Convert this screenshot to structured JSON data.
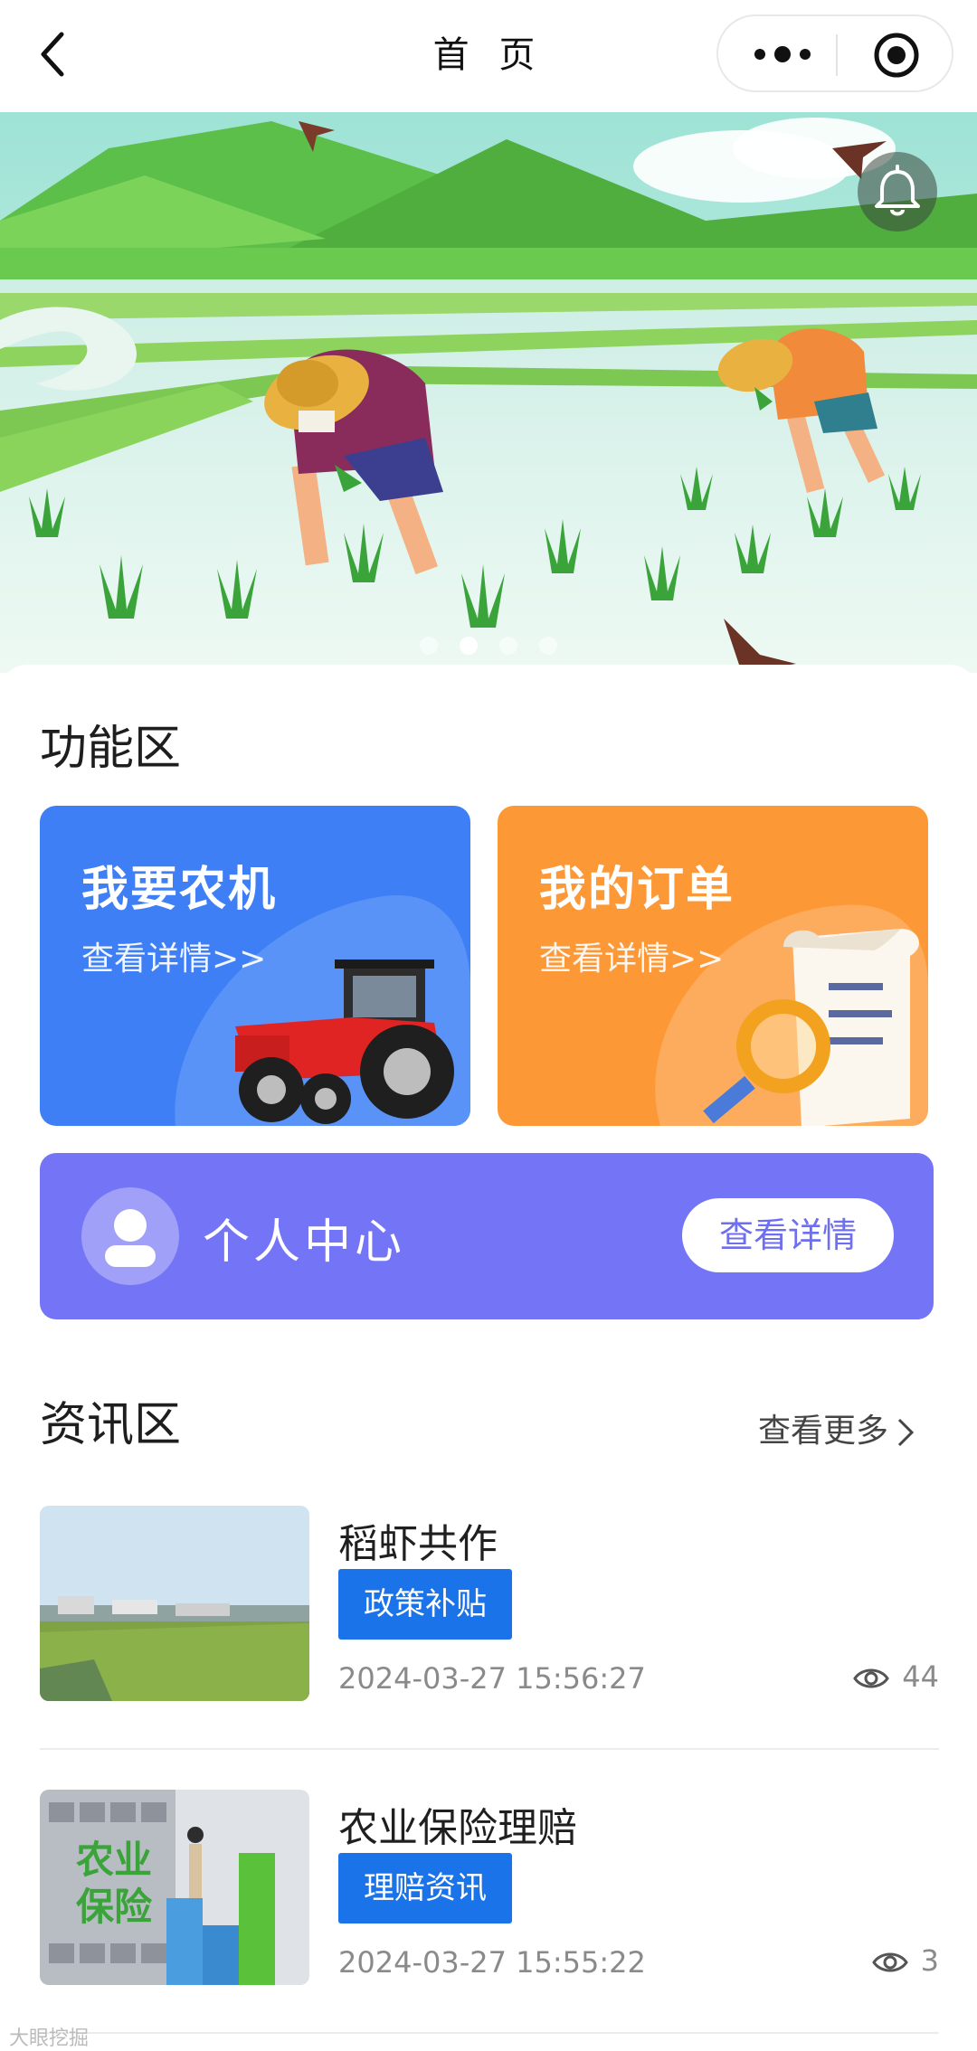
{
  "nav": {
    "title": "首 页",
    "back_icon": "chevron-left-icon",
    "more_icon": "more-dots-icon",
    "close_icon": "target-icon"
  },
  "banner": {
    "notification_icon": "bell-icon",
    "slide_count": 4,
    "active_slide": 2
  },
  "functions": {
    "section_title": "功能区",
    "machinery": {
      "title": "我要农机",
      "subtitle": "查看详情>>",
      "color": "#3f7ff5",
      "icon": "tractor-icon"
    },
    "orders": {
      "title": "我的订单",
      "subtitle": "查看详情>>",
      "color": "#fc9836",
      "icon": "order-scroll-icon"
    },
    "personal": {
      "title": "个人中心",
      "button": "查看详情",
      "color": "#7474f6",
      "icon": "user-icon"
    }
  },
  "news": {
    "section_title": "资讯区",
    "more_label": "查看更多",
    "items": [
      {
        "title": "稻虾共作",
        "tag": "政策补贴",
        "time": "2024-03-27 15:56:27",
        "views": "44"
      },
      {
        "title": "农业保险理赔",
        "tag": "理赔资讯",
        "time": "2024-03-27 15:55:22",
        "views": "3"
      }
    ],
    "tag_color": "#1a73e8"
  },
  "thumb_text": {
    "insurance_line1": "农业",
    "insurance_line2": "保险"
  },
  "watermark": "大眼挖掘"
}
